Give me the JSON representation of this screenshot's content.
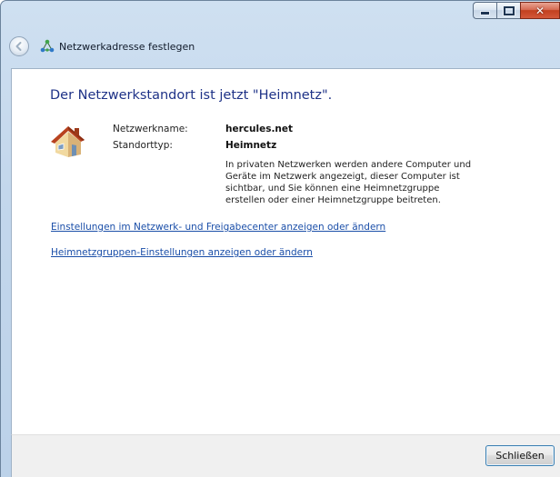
{
  "window": {
    "caption_buttons": {
      "minimize": "minimize",
      "maximize": "maximize",
      "close": "✕"
    }
  },
  "header": {
    "title": "Netzwerkadresse festlegen"
  },
  "main": {
    "heading": "Der Netzwerkstandort ist jetzt \"Heimnetz\".",
    "network_name_label": "Netzwerkname:",
    "network_name_value": "hercules.net",
    "location_type_label": "Standorttyp:",
    "location_type_value": "Heimnetz",
    "description_lines": [
      "In privaten Netzwerken werden andere Computer und",
      "Geräte im Netzwerk angezeigt, dieser Computer ist",
      "sichtbar, und Sie können eine Heimnetzgruppe",
      "erstellen oder einer Heimnetzgruppe beitreten."
    ],
    "links": {
      "network_center": "Einstellungen im Netzwerk- und Freigabecenter anzeigen oder ändern",
      "homegroup": "Heimnetzgruppen-Einstellungen anzeigen oder ändern"
    }
  },
  "footer": {
    "close_label": "Schließen"
  },
  "icons": {
    "back": "back-arrow-icon",
    "network": "network-icon",
    "house": "house-icon"
  },
  "colors": {
    "heading": "#1e3287",
    "link": "#1a4ea8",
    "close_button": "#c2401f"
  }
}
